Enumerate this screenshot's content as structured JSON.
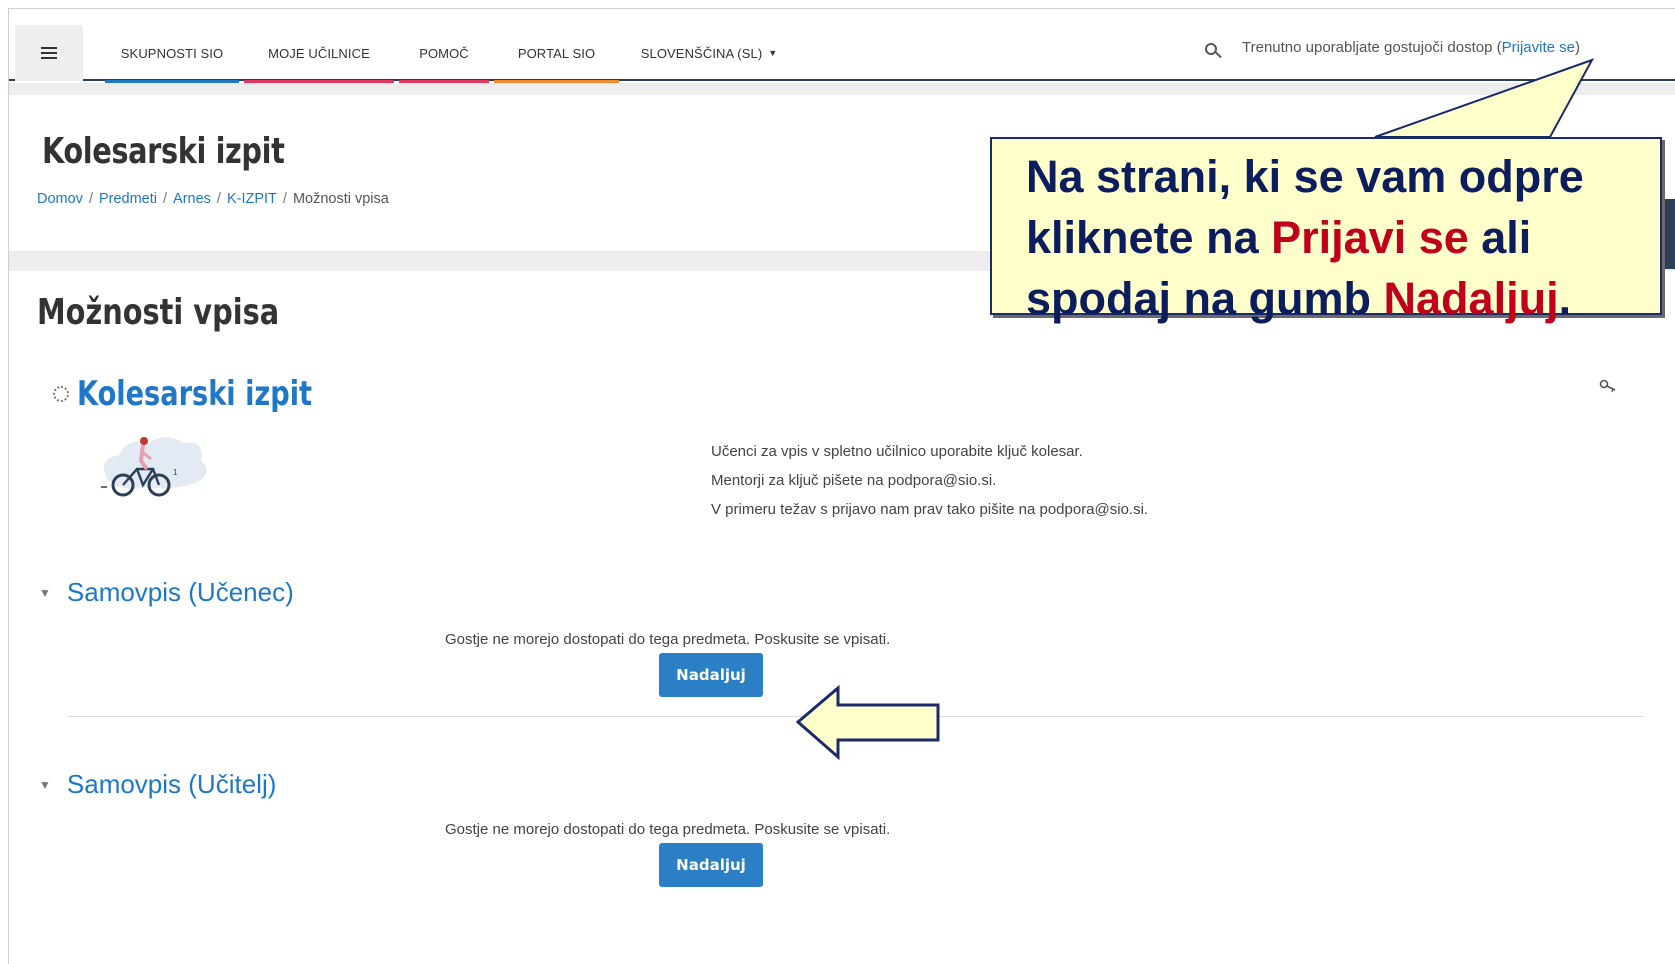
{
  "navbar": {
    "items": [
      {
        "label": "SKUPNOSTI SIO",
        "underline": "#1f77c8"
      },
      {
        "label": "MOJE UČILNICE",
        "underline": "#e0365f"
      },
      {
        "label": "POMOČ",
        "underline": "#e0365f"
      },
      {
        "label": "PORTAL SIO",
        "underline": "#f08a2c"
      },
      {
        "label": "SLOVENŠČINA (SL)",
        "underline": "#2b3f56"
      }
    ],
    "guest_prefix": "Trenutno uporabljate gostujoči dostop (",
    "login_link": "Prijavite se",
    "guest_suffix": ")"
  },
  "header": {
    "course_title": "Kolesarski izpit",
    "breadcrumb": [
      "Domov",
      "Predmeti",
      "Arnes",
      "K-IZPIT",
      "Možnosti vpisa"
    ]
  },
  "main": {
    "page_heading": "Možnosti vpisa",
    "course_link": "Kolesarski izpit",
    "summary_lines": [
      "Učenci za vpis v spletno učilnico uporabite ključ kolesar.",
      "Mentorji za ključ pišete na podpora@sio.si.",
      "V primeru težav s prijavo nam prav tako pišite na podpora@sio.si."
    ],
    "sections": [
      {
        "heading": "Samovpis (Učenec)",
        "notice": "Gostje ne morejo dostopati do tega predmeta. Poskusite se vpisati.",
        "button": "Nadaljuj"
      },
      {
        "heading": "Samovpis (Učitelj)",
        "notice": "Gostje ne morejo dostopati do tega predmeta. Poskusite se vpisati.",
        "button": "Nadaljuj"
      }
    ]
  },
  "callout": {
    "line1": "Na strani, ki se vam odpre",
    "line2_pre": "kliknete na ",
    "line2_red": "Prijavi se",
    "line2_post": " ali",
    "line3_pre": "spodaj na gumb ",
    "line3_red": "Nadaljuj",
    "line3_post": "."
  },
  "icons": {
    "menu": "hamburger-icon",
    "search": "search-icon",
    "key": "key-icon",
    "course_image": "bicycle-illustration",
    "section_toggle": "caret-down-icon"
  },
  "colors": {
    "link": "#1f77c8",
    "button": "#2a7fc5",
    "callout_bg": "#ffffcc",
    "callout_text": "#0b1d5c",
    "callout_highlight": "#c0001a"
  }
}
